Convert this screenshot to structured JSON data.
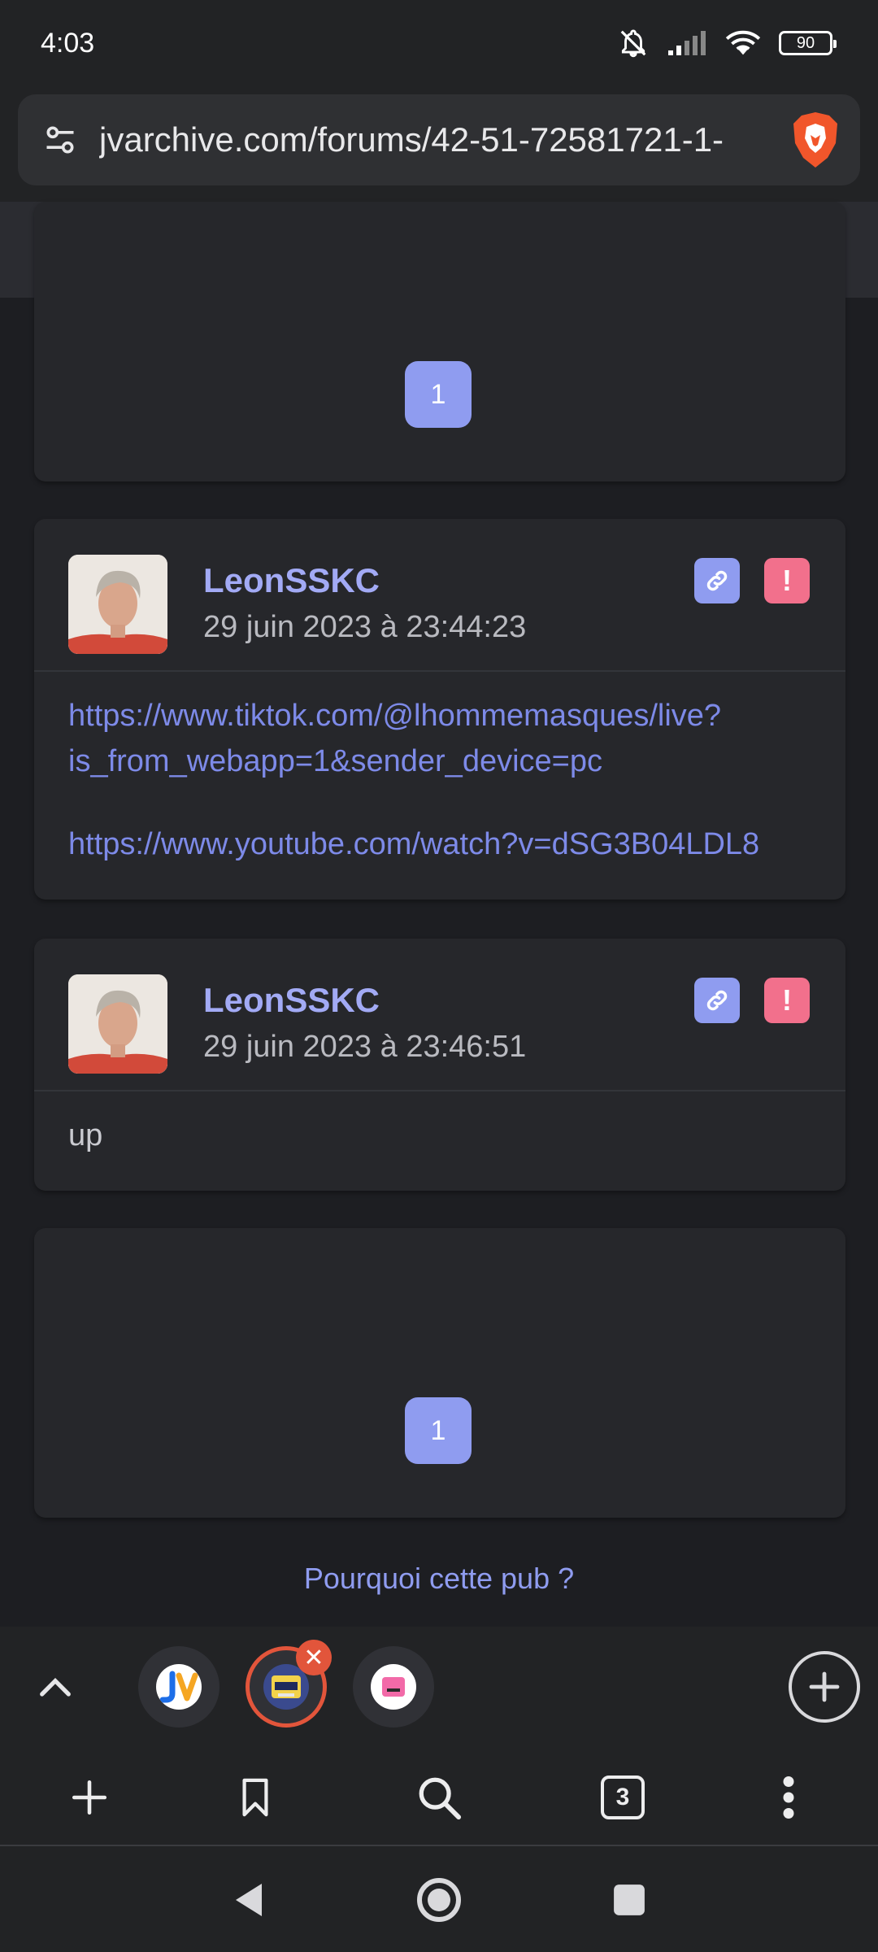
{
  "status_bar": {
    "time": "4:03",
    "battery": "90",
    "icons": [
      "bell-off-icon",
      "signal-icon",
      "wifi-icon",
      "battery-icon"
    ]
  },
  "address_bar": {
    "url": "jvarchive.com/forums/42-51-72581721-1-",
    "icons": [
      "site-settings-icon",
      "brave-shields-icon"
    ]
  },
  "pagination_top": {
    "page": "1"
  },
  "posts": [
    {
      "author": "LeonSSKC",
      "date": "29 juin 2023 à 23:44:23",
      "links": [
        "https://www.tiktok.com/@lhommemasques/live?",
        "is_from_webapp=1&sender_device=pc",
        "https://www.youtube.com/watch?v=dSG3B04LDL8"
      ]
    },
    {
      "author": "LeonSSKC",
      "date": "29 juin 2023 à 23:46:51",
      "text": "up"
    }
  ],
  "pagination_bottom": {
    "page": "1"
  },
  "ad_notice": "Pourquoi cette pub ?",
  "tab_strip": {
    "tabs": [
      "jv-tab",
      "active-tab",
      "pink-tab"
    ],
    "close_label": "✕"
  },
  "toolbar": {
    "tab_count": "3",
    "icons": [
      "new-tab-icon",
      "bookmark-icon",
      "search-icon",
      "tab-count",
      "more-icon"
    ]
  },
  "colors": {
    "accent": "#8f9cf0",
    "author": "#a2aaf5",
    "link": "#7d8ae8",
    "report": "#f2708c",
    "close": "#e2553b"
  }
}
